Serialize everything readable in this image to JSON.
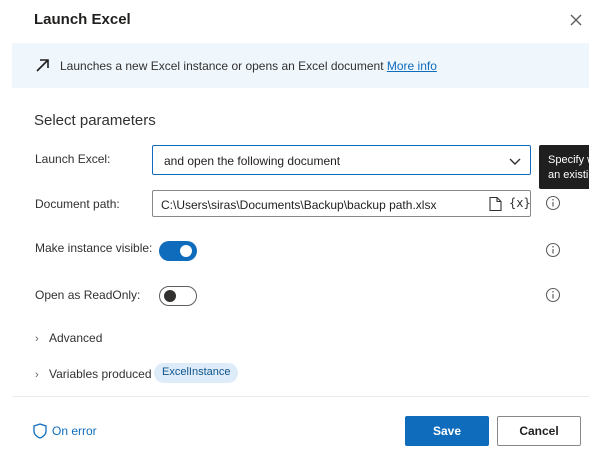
{
  "dialog": {
    "title": "Launch Excel",
    "close_label": "×"
  },
  "banner": {
    "text": "Launches a new Excel instance or opens an Excel document",
    "link": "More info"
  },
  "section_title": "Select parameters",
  "fields": {
    "launch_excel": {
      "label": "Launch Excel:",
      "value": "and open the following document"
    },
    "document_path": {
      "label": "Document path:",
      "value": "C:\\Users\\siras\\Documents\\Backup\\backup path.xlsx",
      "variable_button": "{x}"
    },
    "make_visible": {
      "label": "Make instance visible:",
      "state": "on"
    },
    "read_only": {
      "label": "Open as ReadOnly:",
      "state": "off"
    }
  },
  "tooltip": {
    "line1": "Specify w",
    "line2": "an existi"
  },
  "advanced": {
    "label": "Advanced"
  },
  "variables": {
    "label": "Variables produced",
    "pill": "ExcelInstance"
  },
  "footer": {
    "on_error": "On error",
    "save": "Save",
    "cancel": "Cancel"
  },
  "colors": {
    "accent": "#0f6cbd",
    "banner_bg": "#eff6fc",
    "pill_bg": "#deecf9"
  }
}
